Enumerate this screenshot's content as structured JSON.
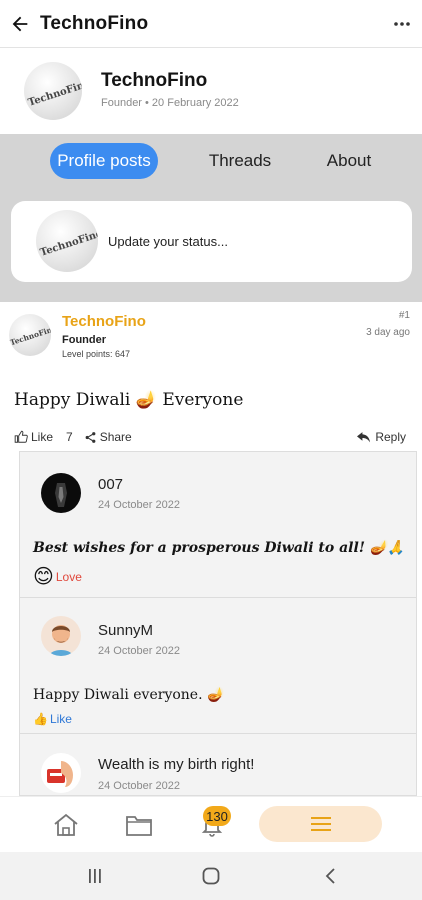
{
  "topbar": {
    "title": "TechnoFino"
  },
  "profile": {
    "name": "TechnoFino",
    "meta": "Founder • 20 February 2022",
    "logo_text": "TechnoFino"
  },
  "tabs": [
    {
      "label": "Profile posts",
      "active": true
    },
    {
      "label": "Threads",
      "active": false
    },
    {
      "label": "About",
      "active": false
    }
  ],
  "status": {
    "placeholder": "Update your status..."
  },
  "post": {
    "author": "TechnoFino",
    "role": "Founder",
    "level": "Level points: 647",
    "number": "#1",
    "time": "3 day ago",
    "body": "Happy Diwali 🪔 Everyone",
    "like_label": "Like",
    "like_count": "7",
    "share_label": "Share",
    "reply_label": "Reply"
  },
  "comments": [
    {
      "name": "007",
      "date": "24 October 2022",
      "text": "Best wishes for a prosperous Diwali to all! 🪔🙏",
      "reaction": "Love",
      "reaction_emoji": "😊",
      "reaction_color": "#e0483c"
    },
    {
      "name": "SunnyM",
      "date": "24 October 2022",
      "text": "Happy Diwali everyone. 🪔",
      "reaction": "Like",
      "reaction_emoji": "👍",
      "reaction_color": "#2f78d6"
    },
    {
      "name": "Wealth is my birth right!",
      "date": "24 October 2022"
    }
  ],
  "bottom_nav": {
    "badge": "130",
    "accent": "#f2a91a"
  },
  "colors": {
    "tab_active": "#3c8cf0",
    "author_name": "#e8a317",
    "grey_area": "#d4d4d4"
  }
}
